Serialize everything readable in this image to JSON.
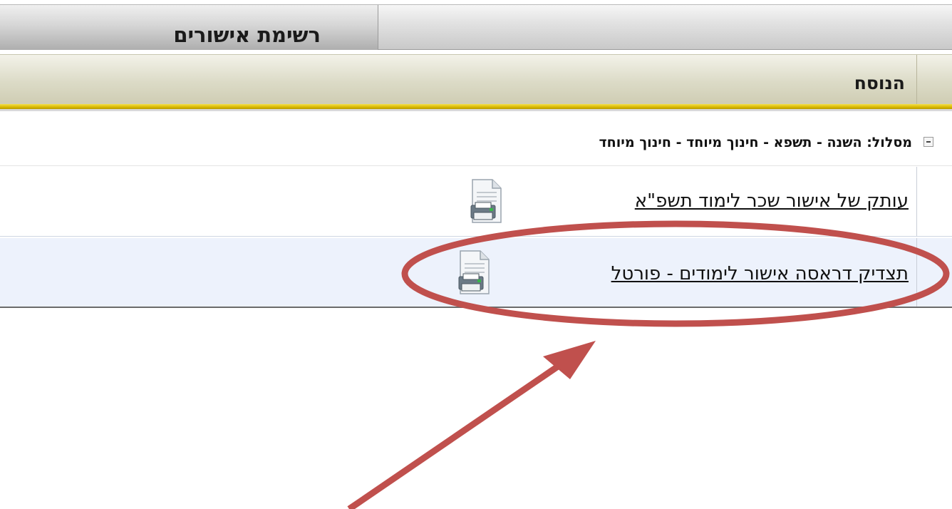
{
  "header": {
    "title": "רשימת אישורים"
  },
  "table": {
    "column_header": "הנוסח",
    "group": {
      "label": "מסלול: השנה - תשפא - חינוך מיוחד - חינוך מיוחד",
      "state": "expanded"
    },
    "rows": [
      {
        "link_text": "עותק של אישור שכר לימוד תשפ\"א",
        "icon": "printer-document-icon"
      },
      {
        "link_text": "תצדיק דראסה אישור לימודים - פורטל",
        "icon": "printer-document-icon"
      }
    ]
  },
  "annotation": {
    "highlight_color": "#c0504d",
    "shape": "ellipse-around-second-row",
    "pointer": "arrow"
  }
}
